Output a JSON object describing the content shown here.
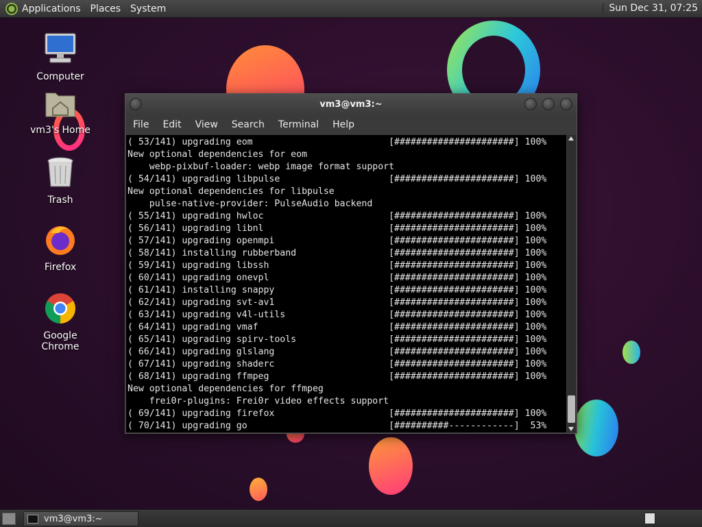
{
  "top_panel": {
    "menus": [
      "Applications",
      "Places",
      "System"
    ],
    "clock": "Sun Dec 31, 07:25"
  },
  "desktop_icons": [
    {
      "label": "Computer",
      "icon": "computer-icon"
    },
    {
      "label": "vm3's Home",
      "icon": "home-folder-icon"
    },
    {
      "label": "Trash",
      "icon": "trash-icon"
    },
    {
      "label": "Firefox",
      "icon": "firefox-icon"
    },
    {
      "label": "Google Chrome",
      "icon": "chrome-icon"
    }
  ],
  "terminal": {
    "title": "vm3@vm3:~",
    "menu": [
      "File",
      "Edit",
      "View",
      "Search",
      "Terminal",
      "Help"
    ],
    "lines": [
      "( 53/141) upgrading eom                         [######################] 100%",
      "New optional dependencies for eom",
      "    webp-pixbuf-loader: webp image format support",
      "( 54/141) upgrading libpulse                    [######################] 100%",
      "New optional dependencies for libpulse",
      "    pulse-native-provider: PulseAudio backend",
      "( 55/141) upgrading hwloc                       [######################] 100%",
      "( 56/141) upgrading libnl                       [######################] 100%",
      "( 57/141) upgrading openmpi                     [######################] 100%",
      "( 58/141) installing rubberband                 [######################] 100%",
      "( 59/141) upgrading libssh                      [######################] 100%",
      "( 60/141) upgrading onevpl                      [######################] 100%",
      "( 61/141) installing snappy                     [######################] 100%",
      "( 62/141) upgrading svt-av1                     [######################] 100%",
      "( 63/141) upgrading v4l-utils                   [######################] 100%",
      "( 64/141) upgrading vmaf                        [######################] 100%",
      "( 65/141) upgrading spirv-tools                 [######################] 100%",
      "( 66/141) upgrading glslang                     [######################] 100%",
      "( 67/141) upgrading shaderc                     [######################] 100%",
      "( 68/141) upgrading ffmpeg                      [######################] 100%",
      "New optional dependencies for ffmpeg",
      "    frei0r-plugins: Frei0r video effects support",
      "( 69/141) upgrading firefox                     [######################] 100%",
      "( 70/141) upgrading go                          [##########------------]  53%"
    ]
  },
  "taskbar": {
    "task_label": "vm3@vm3:~"
  },
  "colors": {
    "desktop_bg": "#2a0e2a",
    "terminal_bg": "#000000",
    "terminal_fg": "#e6e6e6"
  }
}
